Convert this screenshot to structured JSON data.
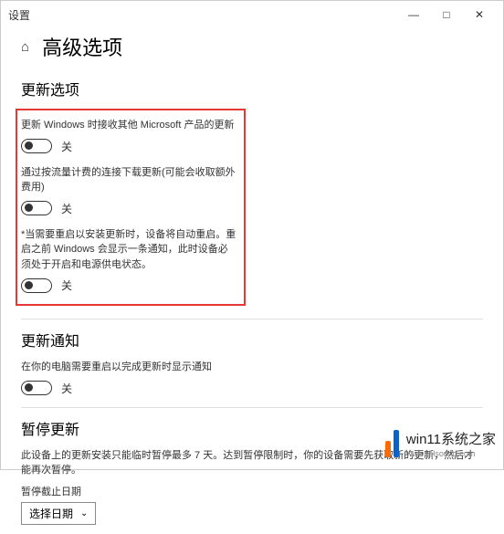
{
  "window": {
    "title": "设置"
  },
  "page": {
    "title": "高级选项"
  },
  "sections": {
    "update_options": {
      "title": "更新选项",
      "opt1": {
        "label": "更新 Windows 时接收其他 Microsoft 产品的更新",
        "state": "关"
      },
      "opt2": {
        "label": "通过按流量计费的连接下载更新(可能会收取额外费用)",
        "state": "关"
      },
      "opt3": {
        "label": "当需要重启以安装更新时，设备将自动重启。重启之前 Windows 会显示一条通知，此时设备必须处于开启和电源供电状态。",
        "state": "关"
      }
    },
    "update_notify": {
      "title": "更新通知",
      "opt1": {
        "label": "在你的电脑需要重启以完成更新时显示通知",
        "state": "关"
      }
    },
    "pause": {
      "title": "暂停更新",
      "desc": "此设备上的更新安装只能临时暂停最多 7 天。达到暂停限制时，你的设备需要先获取新的更新，然后才能再次暂停。",
      "deadline_label": "暂停截止日期",
      "select_label": "选择日期"
    }
  },
  "icons": {
    "home": "⌂",
    "chevron_down": "⌄",
    "minimize": "—",
    "maximize": "□",
    "close": "✕"
  },
  "watermark": {
    "text": "win11系统之家",
    "url": "www.relsound.com"
  }
}
